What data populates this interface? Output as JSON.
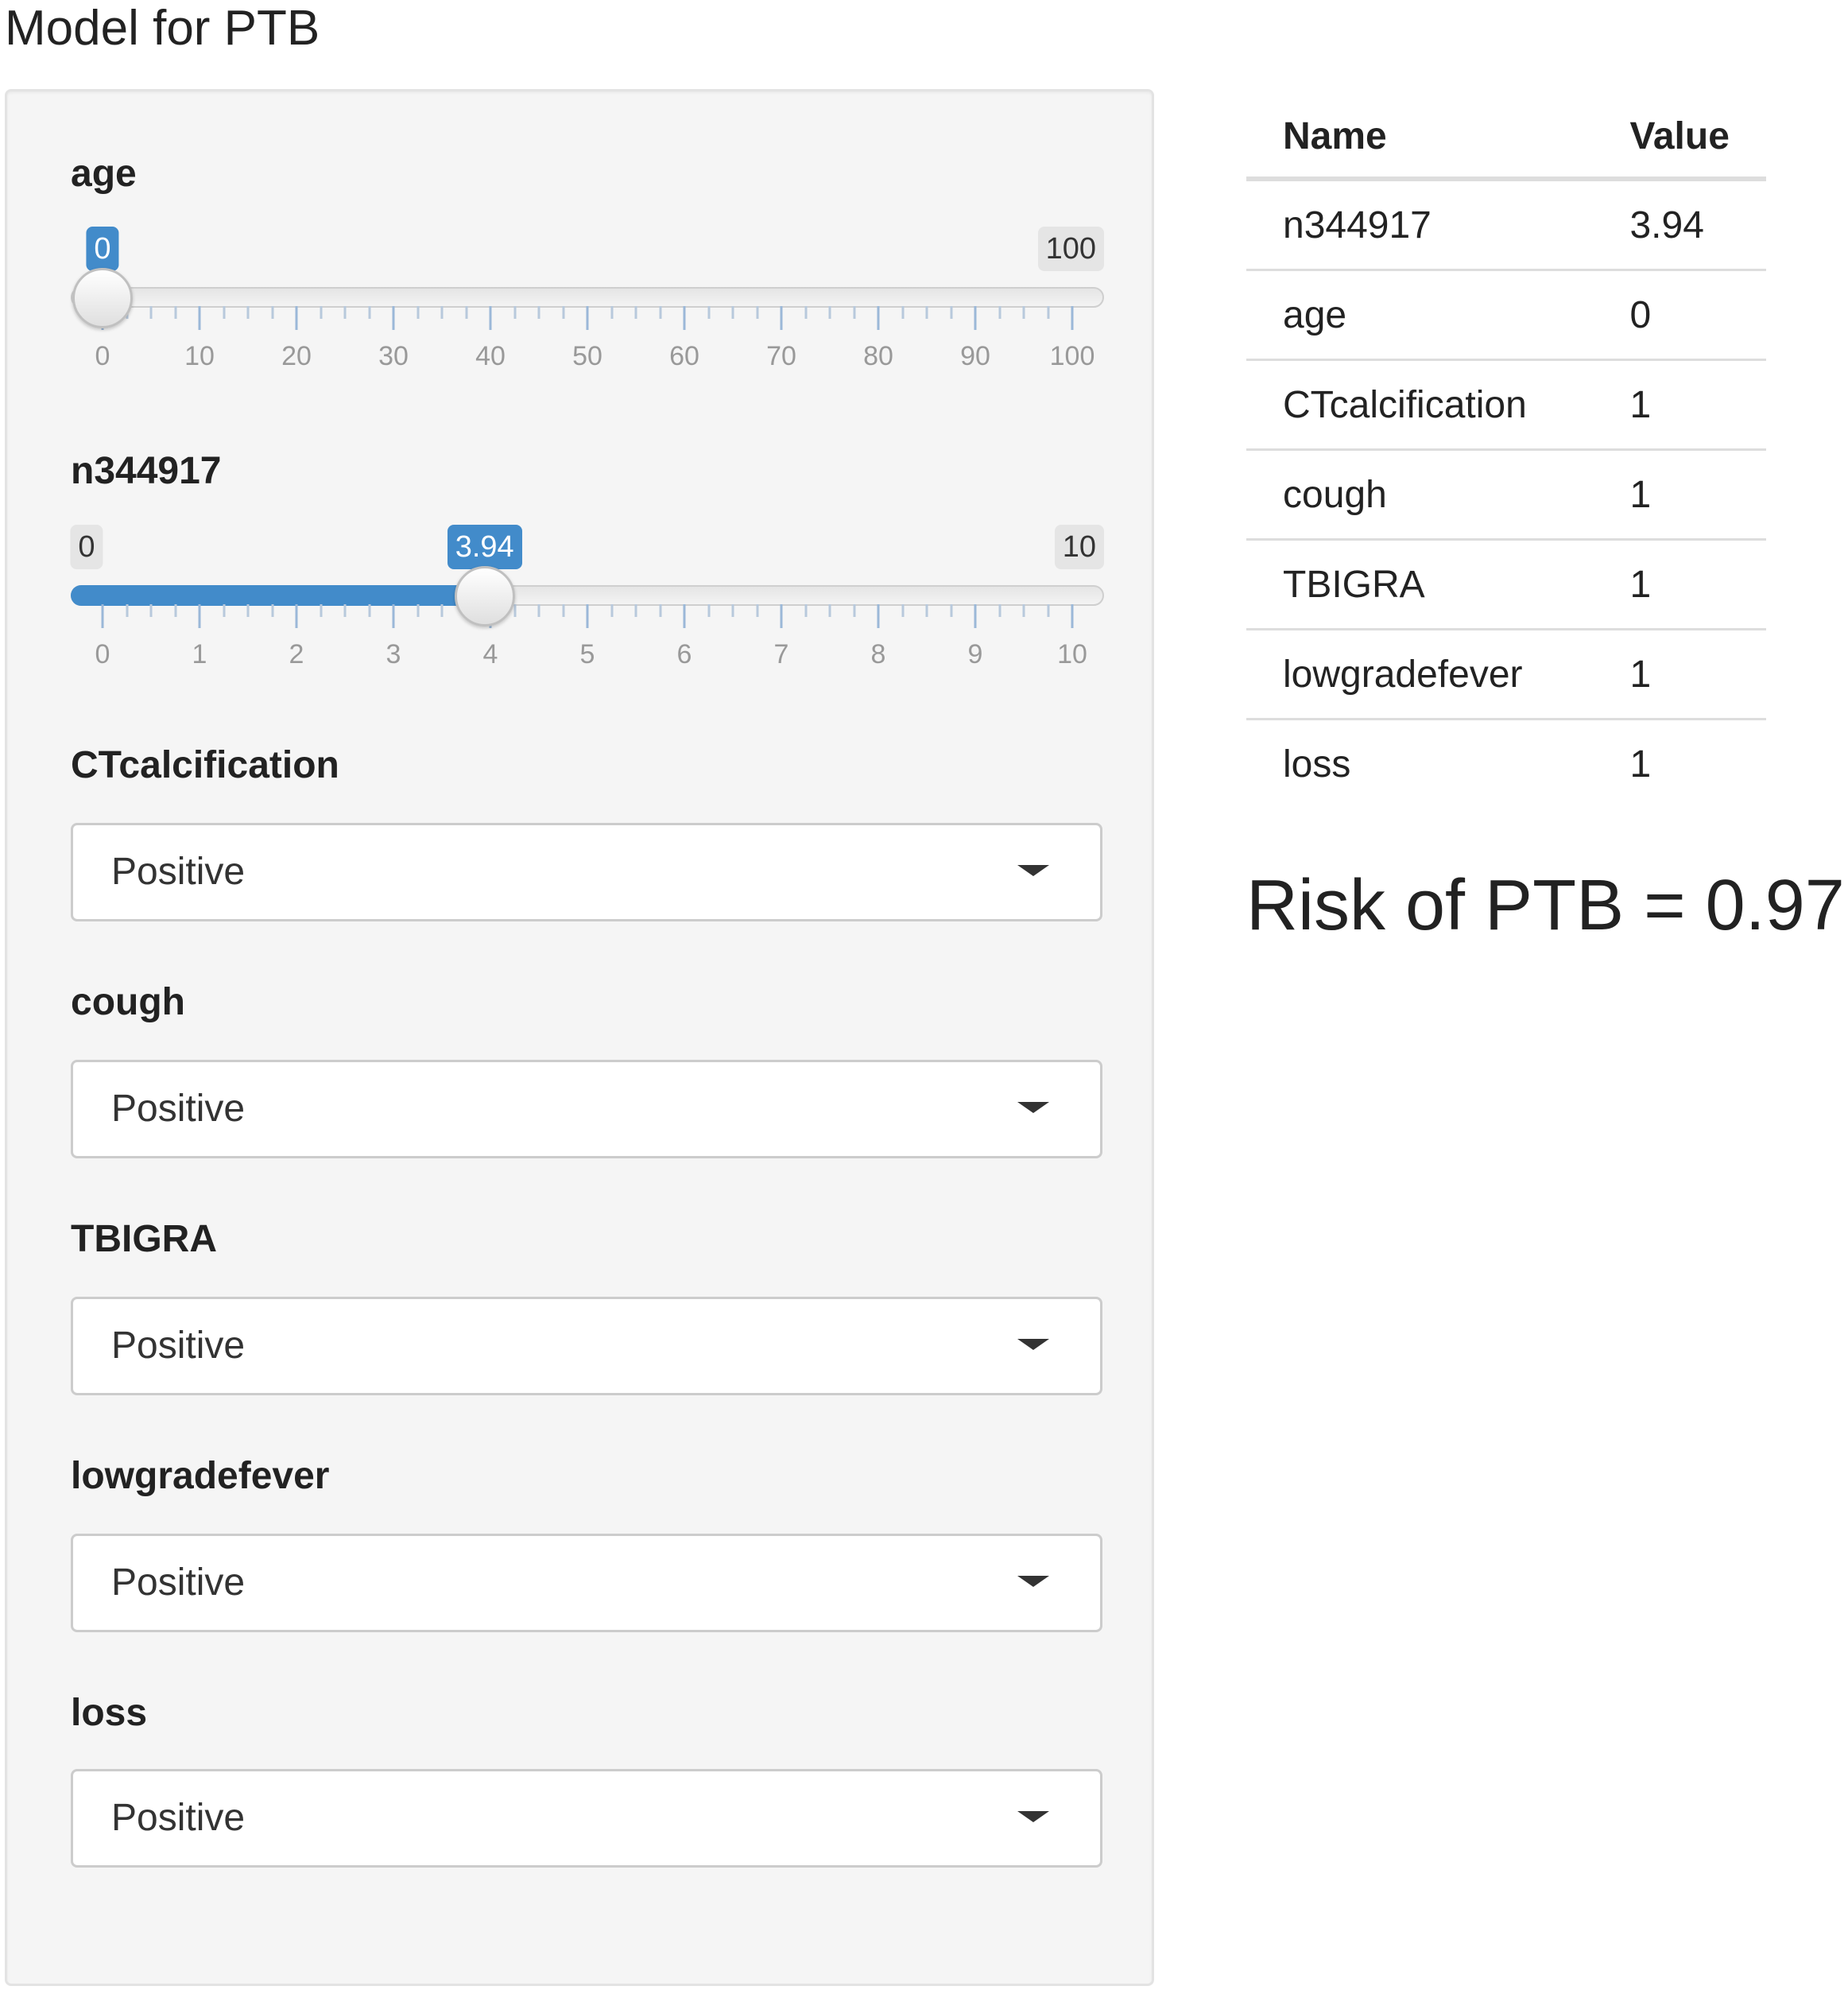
{
  "title": "Model for PTB",
  "sliders": [
    {
      "label": "age",
      "min_label": "",
      "max_label": "100",
      "current_label": "0",
      "value": 0,
      "min": 0,
      "max": 100,
      "tick_labels": [
        "0",
        "10",
        "20",
        "30",
        "40",
        "50",
        "60",
        "70",
        "80",
        "90",
        "100"
      ]
    },
    {
      "label": "n344917",
      "min_label": "0",
      "max_label": "10",
      "current_label": "3.94",
      "value": 3.94,
      "min": 0,
      "max": 10,
      "tick_labels": [
        "0",
        "1",
        "2",
        "3",
        "4",
        "5",
        "6",
        "7",
        "8",
        "9",
        "10"
      ]
    }
  ],
  "selects": [
    {
      "label": "CTcalcification",
      "value": "Positive"
    },
    {
      "label": "cough",
      "value": "Positive"
    },
    {
      "label": "TBIGRA",
      "value": "Positive"
    },
    {
      "label": "lowgradefever",
      "value": "Positive"
    },
    {
      "label": "loss",
      "value": "Positive"
    }
  ],
  "table": {
    "headers": [
      "Name",
      "Value"
    ],
    "rows": [
      [
        "n344917",
        "3.94"
      ],
      [
        "age",
        "0"
      ],
      [
        "CTcalcification",
        "1"
      ],
      [
        "cough",
        "1"
      ],
      [
        "TBIGRA",
        "1"
      ],
      [
        "lowgradefever",
        "1"
      ],
      [
        "loss",
        "1"
      ]
    ]
  },
  "risk_text": "Risk of PTB = 0.97",
  "colors": {
    "accent": "#428bca",
    "well_bg": "#f5f5f5"
  }
}
